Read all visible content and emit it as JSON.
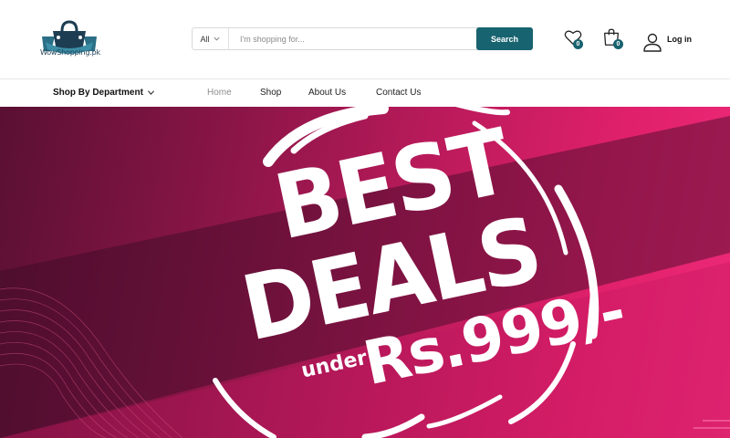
{
  "brand": {
    "name": "WowShopping.pk"
  },
  "search": {
    "category": "All",
    "placeholder": "I'm shopping for...",
    "button_label": "Search"
  },
  "header": {
    "wishlist_count": "0",
    "cart_count": "0",
    "login_label": "Log in"
  },
  "nav": {
    "department_label": "Shop By Department",
    "links": [
      {
        "label": "Home",
        "active": true
      },
      {
        "label": "Shop"
      },
      {
        "label": "About Us"
      },
      {
        "label": "Contact Us"
      }
    ]
  },
  "hero": {
    "line1": "BEST",
    "line2": "DEALS",
    "small": "under",
    "price": "Rs.999/-"
  },
  "colors": {
    "accent": "#17636f",
    "hero_start": "#5a1033",
    "hero_end": "#ee2a78",
    "logo": "#1d3d52"
  }
}
